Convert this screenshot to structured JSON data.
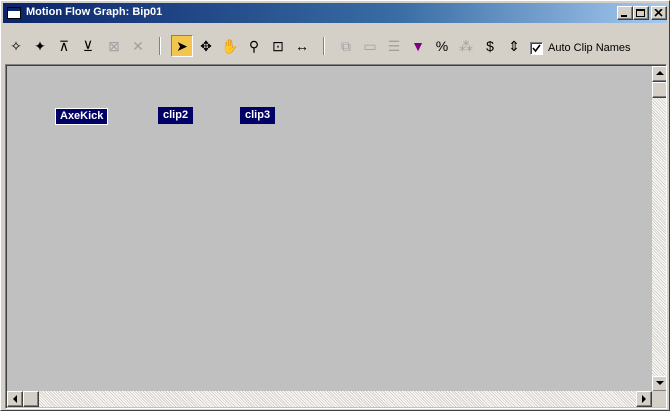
{
  "window": {
    "title": "Motion Flow Graph: Bip01",
    "controls": {
      "minimize": "minimize-icon",
      "maximize": "maximize-icon",
      "close": "close-icon"
    }
  },
  "toolbar": {
    "tools": [
      {
        "name": "create-clip-icon",
        "glyph": "✧",
        "enabled": true
      },
      {
        "name": "create-multiple-clips-icon",
        "glyph": "✦",
        "enabled": true
      },
      {
        "name": "create-transition-icon",
        "glyph": "⊼",
        "enabled": true
      },
      {
        "name": "create-transitions-icon",
        "glyph": "⊻",
        "enabled": true
      },
      {
        "name": "delete-transition-icon",
        "glyph": "⊠",
        "enabled": false
      },
      {
        "name": "delete-icon",
        "glyph": "✕",
        "enabled": false
      },
      {
        "name": "select-arrow-icon",
        "glyph": "➤",
        "enabled": true,
        "active": true
      },
      {
        "name": "move-icon",
        "glyph": "✥",
        "enabled": true
      },
      {
        "name": "pan-hand-icon",
        "glyph": "✋",
        "enabled": true
      },
      {
        "name": "zoom-icon",
        "glyph": "⚲",
        "enabled": true
      },
      {
        "name": "zoom-region-icon",
        "glyph": "⊡",
        "enabled": true
      },
      {
        "name": "zoom-extents-icon",
        "glyph": "↔",
        "enabled": true
      },
      {
        "name": "show-scripts-icon",
        "glyph": "⧉",
        "enabled": false
      },
      {
        "name": "script-bar-icon",
        "glyph": "▭",
        "enabled": false
      },
      {
        "name": "properties-icon",
        "glyph": "☰",
        "enabled": false
      },
      {
        "name": "pick-color-icon",
        "glyph": "▼",
        "enabled": true
      },
      {
        "name": "percent-icon",
        "glyph": "%",
        "enabled": true
      },
      {
        "name": "random-icon",
        "glyph": "⁂",
        "enabled": false
      },
      {
        "name": "cost-icon",
        "glyph": "$",
        "enabled": true
      },
      {
        "name": "optimize-icon",
        "glyph": "⇕",
        "enabled": true
      }
    ],
    "auto_clip_names": {
      "label": "Auto Clip Names",
      "checked": true
    }
  },
  "clips": [
    {
      "label": "AxeKick",
      "selected": true
    },
    {
      "label": "clip2",
      "selected": false
    },
    {
      "label": "clip3",
      "selected": false
    }
  ],
  "colors": {
    "clip_bg": "#000066",
    "canvas_bg": "#c0c0c0",
    "active_tool": "#f2c64c"
  }
}
